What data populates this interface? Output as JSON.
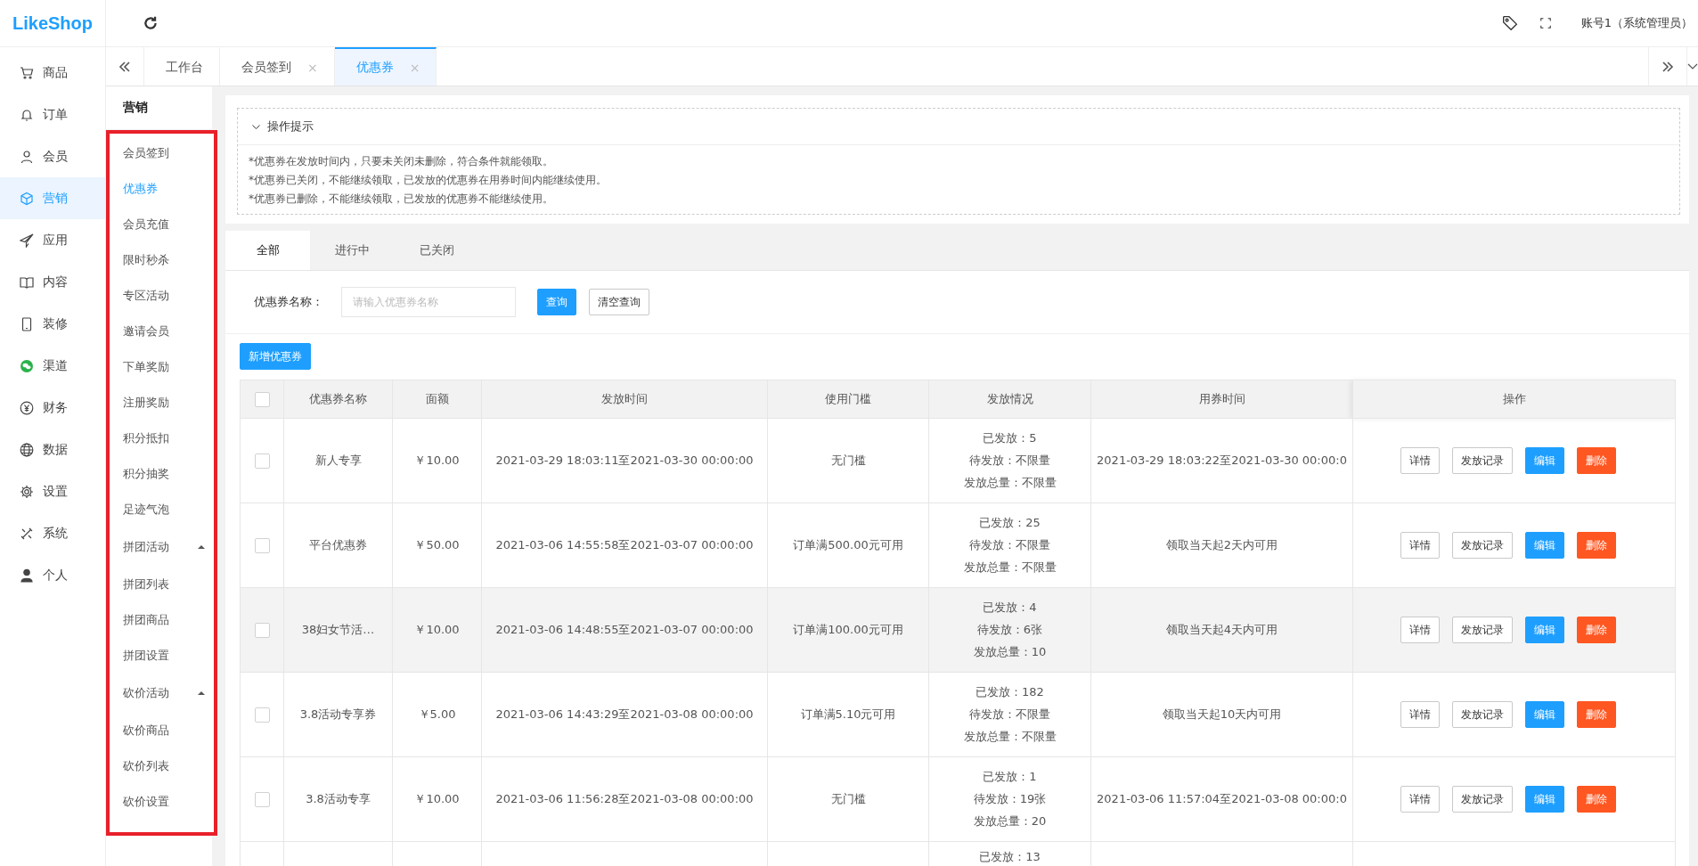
{
  "logo": {
    "text": "LikeShop"
  },
  "header": {
    "account": "账号1（系统管理员）"
  },
  "nav": {
    "items": [
      {
        "label": "商品",
        "selected": false
      },
      {
        "label": "订单",
        "selected": false
      },
      {
        "label": "会员",
        "selected": false
      },
      {
        "label": "营销",
        "selected": true
      },
      {
        "label": "应用",
        "selected": false
      },
      {
        "label": "内容",
        "selected": false
      },
      {
        "label": "装修",
        "selected": false
      },
      {
        "label": "渠道",
        "selected": false
      },
      {
        "label": "财务",
        "selected": false
      },
      {
        "label": "数据",
        "selected": false
      },
      {
        "label": "设置",
        "selected": false
      },
      {
        "label": "系统",
        "selected": false
      },
      {
        "label": "个人",
        "selected": false
      }
    ]
  },
  "page_tabs": [
    {
      "label": "工作台",
      "selected": false
    },
    {
      "label": "会员签到",
      "selected": false,
      "close": "×"
    },
    {
      "label": "优惠券",
      "selected": true,
      "close": "×"
    }
  ],
  "submenu": {
    "title": "营销",
    "items": [
      {
        "kind": "link",
        "label": "会员签到",
        "selected": false
      },
      {
        "kind": "link",
        "label": "优惠券",
        "selected": true
      },
      {
        "kind": "link",
        "label": "会员充值",
        "selected": false
      },
      {
        "kind": "link",
        "label": "限时秒杀",
        "selected": false
      },
      {
        "kind": "link",
        "label": "专区活动",
        "selected": false
      },
      {
        "kind": "link",
        "label": "邀请会员",
        "selected": false
      },
      {
        "kind": "link",
        "label": "下单奖励",
        "selected": false
      },
      {
        "kind": "link",
        "label": "注册奖励",
        "selected": false
      },
      {
        "kind": "link",
        "label": "积分抵扣",
        "selected": false
      },
      {
        "kind": "link",
        "label": "积分抽奖",
        "selected": false
      },
      {
        "kind": "link",
        "label": "足迹气泡",
        "selected": false
      },
      {
        "kind": "group",
        "label": "拼团活动",
        "expanded": true,
        "children": [
          {
            "label": "拼团列表",
            "selected": false
          },
          {
            "label": "拼团商品",
            "selected": false
          },
          {
            "label": "拼团设置",
            "selected": false
          }
        ]
      },
      {
        "kind": "group",
        "label": "砍价活动",
        "expanded": true,
        "children": [
          {
            "label": "砍价商品",
            "selected": false
          },
          {
            "label": "砍价列表",
            "selected": false
          },
          {
            "label": "砍价设置",
            "selected": false
          }
        ]
      }
    ]
  },
  "tips": {
    "title": "操作提示",
    "expanded": true,
    "lines": [
      "*优惠券在发放时间内，只要未关闭未删除，符合条件就能领取。",
      "*优惠券已关闭，不能继续领取，已发放的优惠券在用券时间内能继续使用。",
      "*优惠券已删除，不能继续领取，已发放的优惠券不能继续使用。"
    ]
  },
  "status_tabs": [
    {
      "label": "全部",
      "selected": true
    },
    {
      "label": "进行中",
      "selected": false
    },
    {
      "label": "已关闭",
      "selected": false
    }
  ],
  "search": {
    "label": "优惠券名称：",
    "placeholder": "请输入优惠券名称",
    "buttons": [
      {
        "kind": "primary",
        "label": "查询"
      },
      {
        "kind": "plain",
        "label": "清空查询"
      }
    ]
  },
  "add_button": "新增优惠券",
  "table": {
    "header_checked": false,
    "columns": [
      "优惠券名称",
      "面额",
      "发放时间",
      "使用门槛",
      "发放情况",
      "用券时间",
      "操作"
    ],
    "rows": [
      {
        "checked": false,
        "hovered": false,
        "name": "新人专享",
        "amount": "￥10.00",
        "issue_time": "2021-03-29 18:03:11至2021-03-30 00:00:00",
        "threshold": "无门槛",
        "issued": [
          "已发放：5",
          "待发放：不限量",
          "发放总量：不限量"
        ],
        "use_time": "2021-03-29 18:03:22至2021-03-30 00:00:0",
        "actions": [
          {
            "kind": "plain",
            "label": "详情"
          },
          {
            "kind": "plain",
            "label": "发放记录"
          },
          {
            "kind": "primary",
            "label": "编辑"
          },
          {
            "kind": "danger",
            "label": "删除"
          }
        ]
      },
      {
        "checked": false,
        "hovered": false,
        "name": "平台优惠券",
        "amount": "￥50.00",
        "issue_time": "2021-03-06 14:55:58至2021-03-07 00:00:00",
        "threshold": "订单满500.00元可用",
        "issued": [
          "已发放：25",
          "待发放：不限量",
          "发放总量：不限量"
        ],
        "use_time": "领取当天起2天内可用",
        "actions": [
          {
            "kind": "plain",
            "label": "详情"
          },
          {
            "kind": "plain",
            "label": "发放记录"
          },
          {
            "kind": "primary",
            "label": "编辑"
          },
          {
            "kind": "danger",
            "label": "删除"
          }
        ]
      },
      {
        "checked": false,
        "hovered": true,
        "name": "38妇女节活…",
        "amount": "￥10.00",
        "issue_time": "2021-03-06 14:48:55至2021-03-07 00:00:00",
        "threshold": "订单满100.00元可用",
        "issued": [
          "已发放：4",
          "待发放：6张",
          "发放总量：10"
        ],
        "use_time": "领取当天起4天内可用",
        "actions": [
          {
            "kind": "plain",
            "label": "详情"
          },
          {
            "kind": "plain",
            "label": "发放记录"
          },
          {
            "kind": "primary",
            "label": "编辑"
          },
          {
            "kind": "danger",
            "label": "删除"
          }
        ]
      },
      {
        "checked": false,
        "hovered": false,
        "name": "3.8活动专享券",
        "amount": "￥5.00",
        "issue_time": "2021-03-06 14:43:29至2021-03-08 00:00:00",
        "threshold": "订单满5.10元可用",
        "issued": [
          "已发放：182",
          "待发放：不限量",
          "发放总量：不限量"
        ],
        "use_time": "领取当天起10天内可用",
        "actions": [
          {
            "kind": "plain",
            "label": "详情"
          },
          {
            "kind": "plain",
            "label": "发放记录"
          },
          {
            "kind": "primary",
            "label": "编辑"
          },
          {
            "kind": "danger",
            "label": "删除"
          }
        ]
      },
      {
        "checked": false,
        "hovered": false,
        "name": "3.8活动专享",
        "amount": "￥10.00",
        "issue_time": "2021-03-06 11:56:28至2021-03-08 00:00:00",
        "threshold": "无门槛",
        "issued": [
          "已发放：1",
          "待发放：19张",
          "发放总量：20"
        ],
        "use_time": "2021-03-06 11:57:04至2021-03-08 00:00:0",
        "actions": [
          {
            "kind": "plain",
            "label": "详情"
          },
          {
            "kind": "plain",
            "label": "发放记录"
          },
          {
            "kind": "primary",
            "label": "编辑"
          },
          {
            "kind": "danger",
            "label": "删除"
          }
        ]
      },
      {
        "partial": true,
        "issued": [
          "已发放：13"
        ]
      }
    ]
  }
}
